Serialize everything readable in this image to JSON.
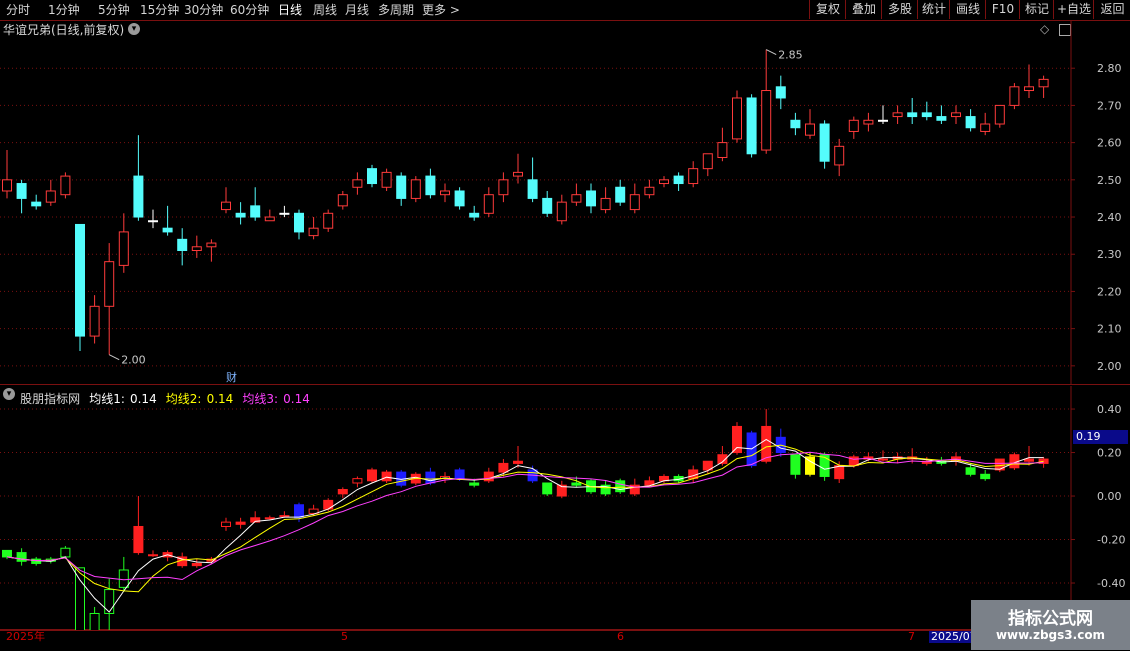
{
  "toolbar": {
    "periods": [
      "分时",
      "1分钟",
      "5分钟",
      "15分钟",
      "30分钟",
      "60分钟",
      "日线",
      "周线",
      "月线",
      "多周期",
      "更多 >"
    ],
    "active_index": 6,
    "right": [
      "复权",
      "叠加",
      "多股",
      "统计",
      "画线",
      "F10",
      "标记",
      "+自选",
      "返回"
    ]
  },
  "main": {
    "title": "华谊兄弟(日线,前复权)",
    "high_label": "2.85",
    "low_label": "2.00",
    "event_marker": "财",
    "y_ticks": [
      "2.80",
      "2.70",
      "2.60",
      "2.50",
      "2.40",
      "2.30",
      "2.20",
      "2.10",
      "2.00"
    ]
  },
  "sub": {
    "name": "股朋指标网",
    "ma1_label": "均线1:",
    "ma1_value": "0.14",
    "ma2_label": "均线2:",
    "ma2_value": "0.14",
    "ma3_label": "均线3:",
    "ma3_value": "0.14",
    "current_value": "0.19",
    "y_ticks": [
      "0.40",
      "0.20",
      "0.00",
      "-0.20",
      "-0.40"
    ]
  },
  "x_axis": {
    "labels": [
      "2025年",
      "5",
      "6",
      "7",
      "2025/07"
    ]
  },
  "watermark": {
    "line1": "指标公式网",
    "line2": "www.zbgs3.com"
  },
  "colors": {
    "up": "#ff3b3b",
    "down": "#54fcfc",
    "sub_up": "#ff2020",
    "sub_down": "#20ff20",
    "sub_blue": "#1e1eff",
    "ma1": "#ffffff",
    "ma2": "#ffff00",
    "ma3": "#ff40ff",
    "grid": "#7a1010"
  },
  "chart_data": [
    {
      "type": "candlestick",
      "title": "华谊兄弟(日线,前复权)",
      "ylim": [
        1.97,
        2.9
      ],
      "y_ticks": [
        2.0,
        2.1,
        2.2,
        2.3,
        2.4,
        2.5,
        2.6,
        2.7,
        2.8
      ],
      "candles": [
        [
          2.47,
          2.5,
          2.58,
          2.45
        ],
        [
          2.49,
          2.45,
          2.5,
          2.41
        ],
        [
          2.44,
          2.43,
          2.46,
          2.42
        ],
        [
          2.44,
          2.47,
          2.5,
          2.43
        ],
        [
          2.46,
          2.51,
          2.52,
          2.45
        ],
        [
          2.38,
          2.08,
          2.38,
          2.04
        ],
        [
          2.08,
          2.16,
          2.19,
          2.06
        ],
        [
          2.16,
          2.28,
          2.33,
          2.03
        ],
        [
          2.27,
          2.36,
          2.41,
          2.25
        ],
        [
          2.51,
          2.4,
          2.62,
          2.39
        ],
        [
          2.39,
          2.39,
          2.42,
          2.37
        ],
        [
          2.37,
          2.36,
          2.43,
          2.35
        ],
        [
          2.34,
          2.31,
          2.37,
          2.27
        ],
        [
          2.31,
          2.32,
          2.35,
          2.29
        ],
        [
          2.32,
          2.33,
          2.34,
          2.28
        ],
        [
          2.42,
          2.44,
          2.48,
          2.41
        ],
        [
          2.41,
          2.4,
          2.44,
          2.38
        ],
        [
          2.43,
          2.4,
          2.48,
          2.39
        ],
        [
          2.39,
          2.4,
          2.42,
          2.39
        ],
        [
          2.41,
          2.41,
          2.43,
          2.4
        ],
        [
          2.41,
          2.36,
          2.42,
          2.34
        ],
        [
          2.35,
          2.37,
          2.4,
          2.34
        ],
        [
          2.37,
          2.41,
          2.42,
          2.36
        ],
        [
          2.43,
          2.46,
          2.47,
          2.42
        ],
        [
          2.48,
          2.5,
          2.52,
          2.46
        ],
        [
          2.53,
          2.49,
          2.54,
          2.48
        ],
        [
          2.48,
          2.52,
          2.53,
          2.47
        ],
        [
          2.51,
          2.45,
          2.52,
          2.43
        ],
        [
          2.45,
          2.5,
          2.51,
          2.44
        ],
        [
          2.51,
          2.46,
          2.53,
          2.45
        ],
        [
          2.46,
          2.47,
          2.49,
          2.44
        ],
        [
          2.47,
          2.43,
          2.48,
          2.42
        ],
        [
          2.41,
          2.4,
          2.43,
          2.39
        ],
        [
          2.41,
          2.46,
          2.48,
          2.4
        ],
        [
          2.46,
          2.5,
          2.52,
          2.44
        ],
        [
          2.51,
          2.52,
          2.57,
          2.49
        ],
        [
          2.5,
          2.45,
          2.56,
          2.44
        ],
        [
          2.45,
          2.41,
          2.47,
          2.4
        ],
        [
          2.39,
          2.44,
          2.46,
          2.38
        ],
        [
          2.44,
          2.46,
          2.49,
          2.43
        ],
        [
          2.47,
          2.43,
          2.49,
          2.41
        ],
        [
          2.42,
          2.45,
          2.48,
          2.41
        ],
        [
          2.48,
          2.44,
          2.5,
          2.43
        ],
        [
          2.42,
          2.46,
          2.49,
          2.41
        ],
        [
          2.46,
          2.48,
          2.5,
          2.45
        ],
        [
          2.49,
          2.5,
          2.51,
          2.48
        ],
        [
          2.51,
          2.49,
          2.52,
          2.47
        ],
        [
          2.49,
          2.53,
          2.55,
          2.48
        ],
        [
          2.53,
          2.57,
          2.57,
          2.51
        ],
        [
          2.56,
          2.6,
          2.64,
          2.55
        ],
        [
          2.61,
          2.72,
          2.74,
          2.6
        ],
        [
          2.72,
          2.57,
          2.73,
          2.56
        ],
        [
          2.58,
          2.74,
          2.85,
          2.57
        ],
        [
          2.75,
          2.72,
          2.78,
          2.69
        ],
        [
          2.66,
          2.64,
          2.68,
          2.62
        ],
        [
          2.62,
          2.65,
          2.69,
          2.61
        ],
        [
          2.65,
          2.55,
          2.66,
          2.53
        ],
        [
          2.54,
          2.59,
          2.61,
          2.51
        ],
        [
          2.63,
          2.66,
          2.67,
          2.61
        ],
        [
          2.65,
          2.66,
          2.68,
          2.63
        ],
        [
          2.66,
          2.66,
          2.7,
          2.65
        ],
        [
          2.67,
          2.68,
          2.7,
          2.65
        ],
        [
          2.68,
          2.67,
          2.72,
          2.65
        ],
        [
          2.68,
          2.67,
          2.71,
          2.66
        ],
        [
          2.67,
          2.66,
          2.7,
          2.65
        ],
        [
          2.67,
          2.68,
          2.7,
          2.65
        ],
        [
          2.67,
          2.64,
          2.69,
          2.63
        ],
        [
          2.63,
          2.65,
          2.68,
          2.62
        ],
        [
          2.65,
          2.7,
          2.7,
          2.64
        ],
        [
          2.7,
          2.75,
          2.76,
          2.69
        ],
        [
          2.74,
          2.75,
          2.81,
          2.72
        ],
        [
          2.75,
          2.77,
          2.78,
          2.72
        ]
      ]
    },
    {
      "type": "candlestick",
      "series_names": [
        "均线1",
        "均线2",
        "均线3"
      ],
      "ylim": [
        -0.57,
        0.46
      ],
      "y_ticks": [
        0.4,
        0.2,
        0.0,
        -0.2,
        -0.4
      ],
      "candles": [
        [
          -0.25,
          -0.28,
          -0.26,
          -0.29
        ],
        [
          -0.26,
          -0.3,
          -0.24,
          -0.32
        ],
        [
          -0.29,
          -0.31,
          -0.28,
          -0.32
        ],
        [
          -0.3,
          -0.29,
          -0.28,
          -0.31
        ],
        [
          -0.28,
          -0.24,
          -0.23,
          -0.29
        ],
        [
          -0.33,
          -0.63,
          -0.33,
          -0.7
        ],
        [
          -0.63,
          -0.54,
          -0.51,
          -0.62
        ],
        [
          -0.54,
          -0.43,
          -0.38,
          -0.68
        ],
        [
          -0.42,
          -0.34,
          -0.28,
          -0.44
        ],
        [
          -0.14,
          -0.26,
          -0.0,
          -0.27
        ],
        [
          -0.27,
          -0.27,
          -0.25,
          -0.28
        ],
        [
          -0.26,
          -0.28,
          -0.25,
          -0.3
        ],
        [
          -0.28,
          -0.32,
          -0.26,
          -0.33
        ],
        [
          -0.32,
          -0.31,
          -0.29,
          -0.33
        ],
        [
          -0.3,
          -0.29,
          -0.28,
          -0.31
        ],
        [
          -0.14,
          -0.12,
          -0.1,
          -0.16
        ],
        [
          -0.12,
          -0.13,
          -0.1,
          -0.15
        ],
        [
          -0.12,
          -0.1,
          -0.07,
          -0.12
        ],
        [
          -0.1,
          -0.1,
          -0.09,
          -0.11
        ],
        [
          -0.09,
          -0.09,
          -0.07,
          -0.1
        ],
        [
          -0.04,
          -0.1,
          -0.03,
          -0.12
        ],
        [
          -0.08,
          -0.06,
          -0.04,
          -0.09
        ],
        [
          -0.06,
          -0.02,
          -0.01,
          -0.07
        ],
        [
          0.01,
          0.03,
          0.04,
          -0.01
        ],
        [
          0.06,
          0.08,
          0.09,
          0.04
        ],
        [
          0.12,
          0.07,
          0.13,
          0.06
        ],
        [
          0.07,
          0.11,
          0.12,
          0.06
        ],
        [
          0.11,
          0.05,
          0.12,
          0.04
        ],
        [
          0.06,
          0.1,
          0.11,
          0.05
        ],
        [
          0.11,
          0.06,
          0.13,
          0.05
        ],
        [
          0.08,
          0.09,
          0.11,
          0.06
        ],
        [
          0.12,
          0.08,
          0.13,
          0.07
        ],
        [
          0.06,
          0.05,
          0.08,
          0.04
        ],
        [
          0.07,
          0.11,
          0.13,
          0.06
        ],
        [
          0.11,
          0.15,
          0.17,
          0.09
        ],
        [
          0.15,
          0.16,
          0.23,
          0.13
        ],
        [
          0.12,
          0.07,
          0.14,
          0.06
        ],
        [
          0.06,
          0.01,
          0.06,
          0.0
        ],
        [
          0.0,
          0.05,
          0.07,
          -0.01
        ],
        [
          0.05,
          0.06,
          0.09,
          0.04
        ],
        [
          0.07,
          0.02,
          0.08,
          0.01
        ],
        [
          0.01,
          0.05,
          0.07,
          0.0
        ],
        [
          0.07,
          0.02,
          0.08,
          0.01
        ],
        [
          0.01,
          0.05,
          0.08,
          0.0
        ],
        [
          0.05,
          0.07,
          0.09,
          0.04
        ],
        [
          0.07,
          0.09,
          0.1,
          0.06
        ],
        [
          0.09,
          0.07,
          0.1,
          0.06
        ],
        [
          0.08,
          0.12,
          0.14,
          0.06
        ],
        [
          0.12,
          0.16,
          0.16,
          0.1
        ],
        [
          0.15,
          0.19,
          0.23,
          0.14
        ],
        [
          0.2,
          0.32,
          0.34,
          0.19
        ],
        [
          0.29,
          0.14,
          0.3,
          0.13
        ],
        [
          0.16,
          0.32,
          0.4,
          0.15
        ],
        [
          0.27,
          0.2,
          0.31,
          0.18
        ],
        [
          0.19,
          0.1,
          0.19,
          0.08
        ],
        [
          0.1,
          0.18,
          0.2,
          0.09
        ],
        [
          0.19,
          0.09,
          0.2,
          0.07
        ],
        [
          0.08,
          0.14,
          0.16,
          0.06
        ],
        [
          0.14,
          0.18,
          0.19,
          0.13
        ],
        [
          0.17,
          0.18,
          0.2,
          0.16
        ],
        [
          0.17,
          0.17,
          0.21,
          0.16
        ],
        [
          0.17,
          0.18,
          0.2,
          0.15
        ],
        [
          0.18,
          0.17,
          0.22,
          0.15
        ],
        [
          0.16,
          0.15,
          0.18,
          0.14
        ],
        [
          0.16,
          0.15,
          0.18,
          0.14
        ],
        [
          0.16,
          0.18,
          0.2,
          0.14
        ],
        [
          0.13,
          0.1,
          0.15,
          0.09
        ],
        [
          0.08,
          0.1,
          0.12,
          0.07
        ],
        [
          0.12,
          0.17,
          0.17,
          0.11
        ],
        [
          0.13,
          0.19,
          0.2,
          0.12
        ],
        [
          0.16,
          0.17,
          0.23,
          0.14
        ],
        [
          0.15,
          0.17,
          0.18,
          0.13
        ]
      ],
      "colors_per_candle": [
        "g",
        "g",
        "g",
        "g",
        "g",
        "g",
        "g",
        "g",
        "g",
        "r",
        "r",
        "r",
        "r",
        "r",
        "r",
        "r",
        "r",
        "r",
        "r",
        "r",
        "b",
        "r",
        "r",
        "r",
        "r",
        "r",
        "r",
        "b",
        "r",
        "b",
        "r",
        "b",
        "g",
        "r",
        "r",
        "r",
        "b",
        "g",
        "r",
        "g",
        "g",
        "g",
        "g",
        "r",
        "r",
        "r",
        "g",
        "r",
        "r",
        "r",
        "r",
        "b",
        "r",
        "b",
        "g",
        "y",
        "g",
        "r",
        "r",
        "r",
        "r",
        "r",
        "r",
        "r",
        "g",
        "r",
        "g",
        "g",
        "r",
        "r",
        "r",
        "r"
      ]
    }
  ]
}
